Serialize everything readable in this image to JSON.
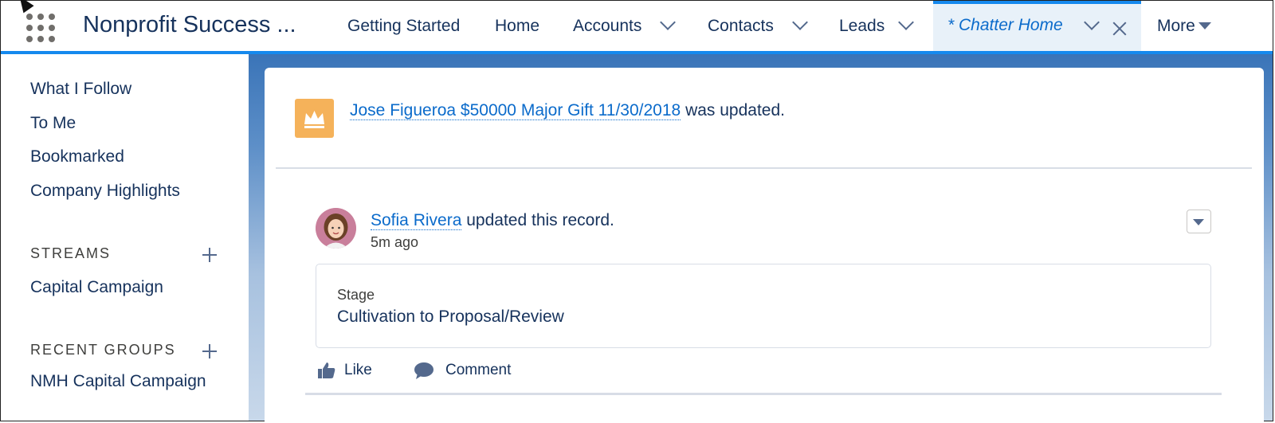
{
  "nav": {
    "app_name": "Nonprofit Success ...",
    "tabs": [
      {
        "label": "Getting Started"
      },
      {
        "label": "Home"
      },
      {
        "label": "Accounts"
      },
      {
        "label": "Contacts"
      },
      {
        "label": "Leads"
      }
    ],
    "active_tab": "* Chatter Home",
    "more_label": "More",
    "accent_color": "#1589ee"
  },
  "sidebar": {
    "links": [
      "What I Follow",
      "To Me",
      "Bookmarked",
      "Company Highlights"
    ],
    "streams_heading": "STREAMS",
    "streams": [
      "Capital Campaign"
    ],
    "groups_heading": "RECENT GROUPS",
    "groups": [
      "NMH Capital Campaign"
    ]
  },
  "feed": {
    "record_link": "Jose Figueroa $50000 Major Gift 11/30/2018",
    "record_suffix": "was updated.",
    "record_icon": "crown-icon",
    "author": "Sofia Rivera",
    "author_suffix": "updated this record.",
    "time": "5m ago",
    "field_label": "Stage",
    "field_value": "Cultivation to Proposal/Review",
    "like_label": "Like",
    "comment_label": "Comment"
  }
}
